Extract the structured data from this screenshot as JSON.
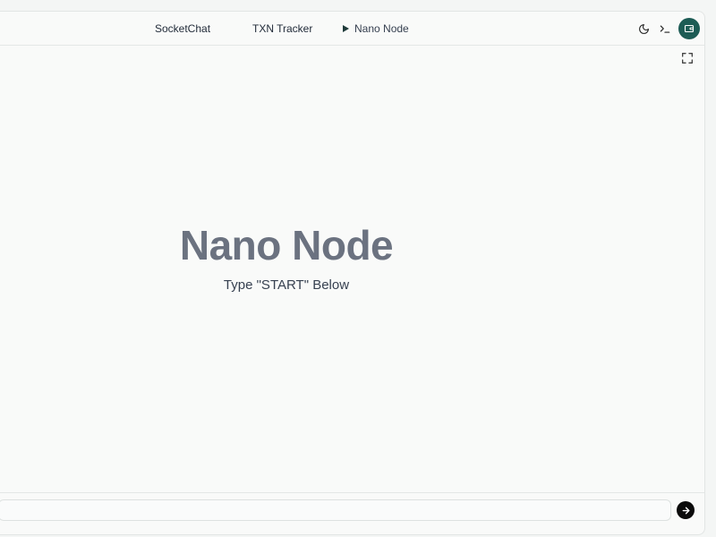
{
  "nav": {
    "items": [
      {
        "label": "SocketChat"
      },
      {
        "label": "TXN Tracker"
      },
      {
        "label": "Nano Node",
        "active": true
      }
    ]
  },
  "toolbar": {
    "theme_icon": "moon-icon",
    "terminal_icon": "terminal-icon",
    "wallet_icon": "wallet-icon",
    "expand_icon": "fullscreen-icon"
  },
  "main": {
    "title": "Nano Node",
    "subtitle": "Type \"START\" Below"
  },
  "chat": {
    "input_value": "",
    "input_placeholder": "",
    "send_icon": "arrow-right-icon"
  },
  "colors": {
    "accent": "#1d5c55",
    "title": "#6b7280",
    "send_button": "#0b0b0b"
  }
}
